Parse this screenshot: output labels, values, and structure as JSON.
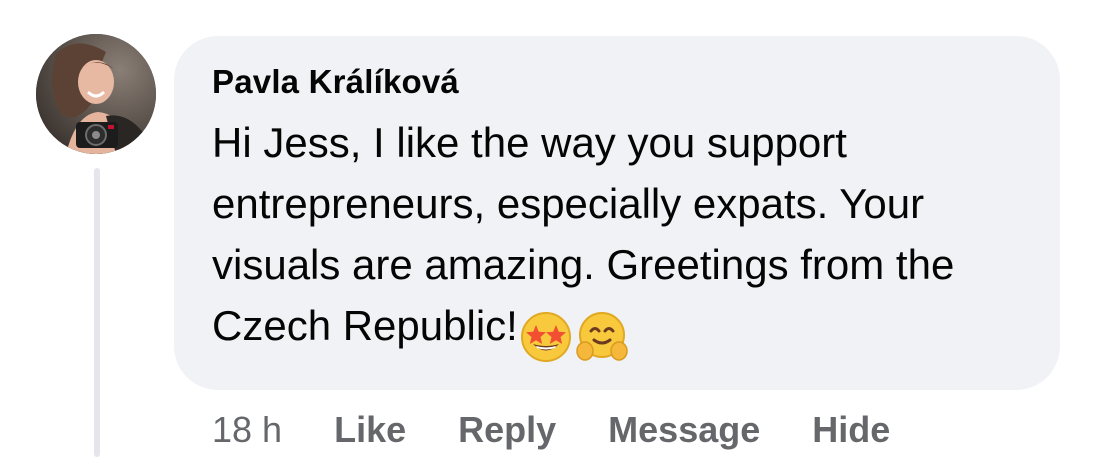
{
  "comment": {
    "author": "Pavla Králíková",
    "text": "Hi Jess, I like the way you support entrepreneurs, especially expats. Your visuals are amazing. Greetings from the Czech Republic!",
    "emojis": [
      "star-struck-emoji",
      "hugging-face-emoji"
    ],
    "timestamp": "18 h",
    "actions": {
      "like": "Like",
      "reply": "Reply",
      "message": "Message",
      "hide": "Hide"
    }
  },
  "colors": {
    "bubble": "#f0f2f5",
    "text": "#050505",
    "secondary_text": "#65676b",
    "thread_line": "#e4e6eb"
  }
}
